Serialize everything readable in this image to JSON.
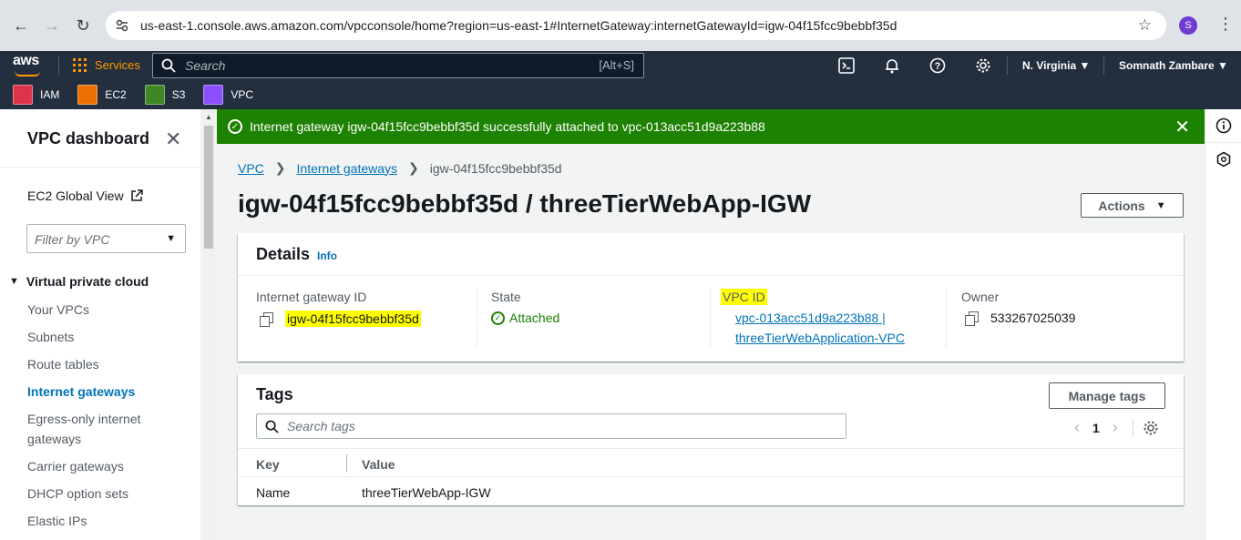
{
  "browser": {
    "url": "us-east-1.console.aws.amazon.com/vpcconsole/home?region=us-east-1#InternetGateway:internetGatewayId=igw-04f15fcc9bebbf35d",
    "profile_initial": "S"
  },
  "topnav": {
    "logo": "aws",
    "services_label": "Services",
    "search_placeholder": "Search",
    "search_shortcut": "[Alt+S]",
    "region": "N. Virginia",
    "user": "Somnath Zambare",
    "icons": [
      "cloudshell-icon",
      "notifications-icon",
      "help-icon",
      "settings-icon"
    ]
  },
  "favorites": [
    {
      "label": "IAM",
      "color": "#dd344c"
    },
    {
      "label": "EC2",
      "color": "#ed7100"
    },
    {
      "label": "S3",
      "color": "#3f8624"
    },
    {
      "label": "VPC",
      "color": "#8c4fff"
    }
  ],
  "sidebar": {
    "title": "VPC dashboard",
    "ec2_global_view": "EC2 Global View",
    "filter_placeholder": "Filter by VPC",
    "section": "Virtual private cloud",
    "items": [
      {
        "label": "Your VPCs"
      },
      {
        "label": "Subnets"
      },
      {
        "label": "Route tables"
      },
      {
        "label": "Internet gateways",
        "active": true
      },
      {
        "label": "Egress-only internet gateways"
      },
      {
        "label": "Carrier gateways"
      },
      {
        "label": "DHCP option sets"
      },
      {
        "label": "Elastic IPs"
      }
    ]
  },
  "flash": {
    "message": "Internet gateway igw-04f15fcc9bebbf35d successfully attached to vpc-013acc51d9a223b88",
    "color": "#1d8102"
  },
  "breadcrumbs": {
    "root": "VPC",
    "parent": "Internet gateways",
    "current": "igw-04f15fcc9bebbf35d"
  },
  "page": {
    "title": "igw-04f15fcc9bebbf35d / threeTierWebApp-IGW",
    "actions_label": "Actions"
  },
  "details": {
    "heading": "Details",
    "info_label": "Info",
    "fields": {
      "igw_id_label": "Internet gateway ID",
      "igw_id_value": "igw-04f15fcc9bebbf35d",
      "state_label": "State",
      "state_value": "Attached",
      "vpc_id_label": "VPC ID",
      "vpc_id_line1": "vpc-013acc51d9a223b88 |",
      "vpc_id_line2": "threeTierWebApplication-VPC",
      "owner_label": "Owner",
      "owner_value": "533267025039"
    }
  },
  "tags": {
    "heading": "Tags",
    "manage_label": "Manage tags",
    "search_placeholder": "Search tags",
    "page": "1",
    "columns": [
      "Key",
      "Value"
    ],
    "rows": [
      {
        "key": "Name",
        "value": "threeTierWebApp-IGW"
      }
    ]
  }
}
